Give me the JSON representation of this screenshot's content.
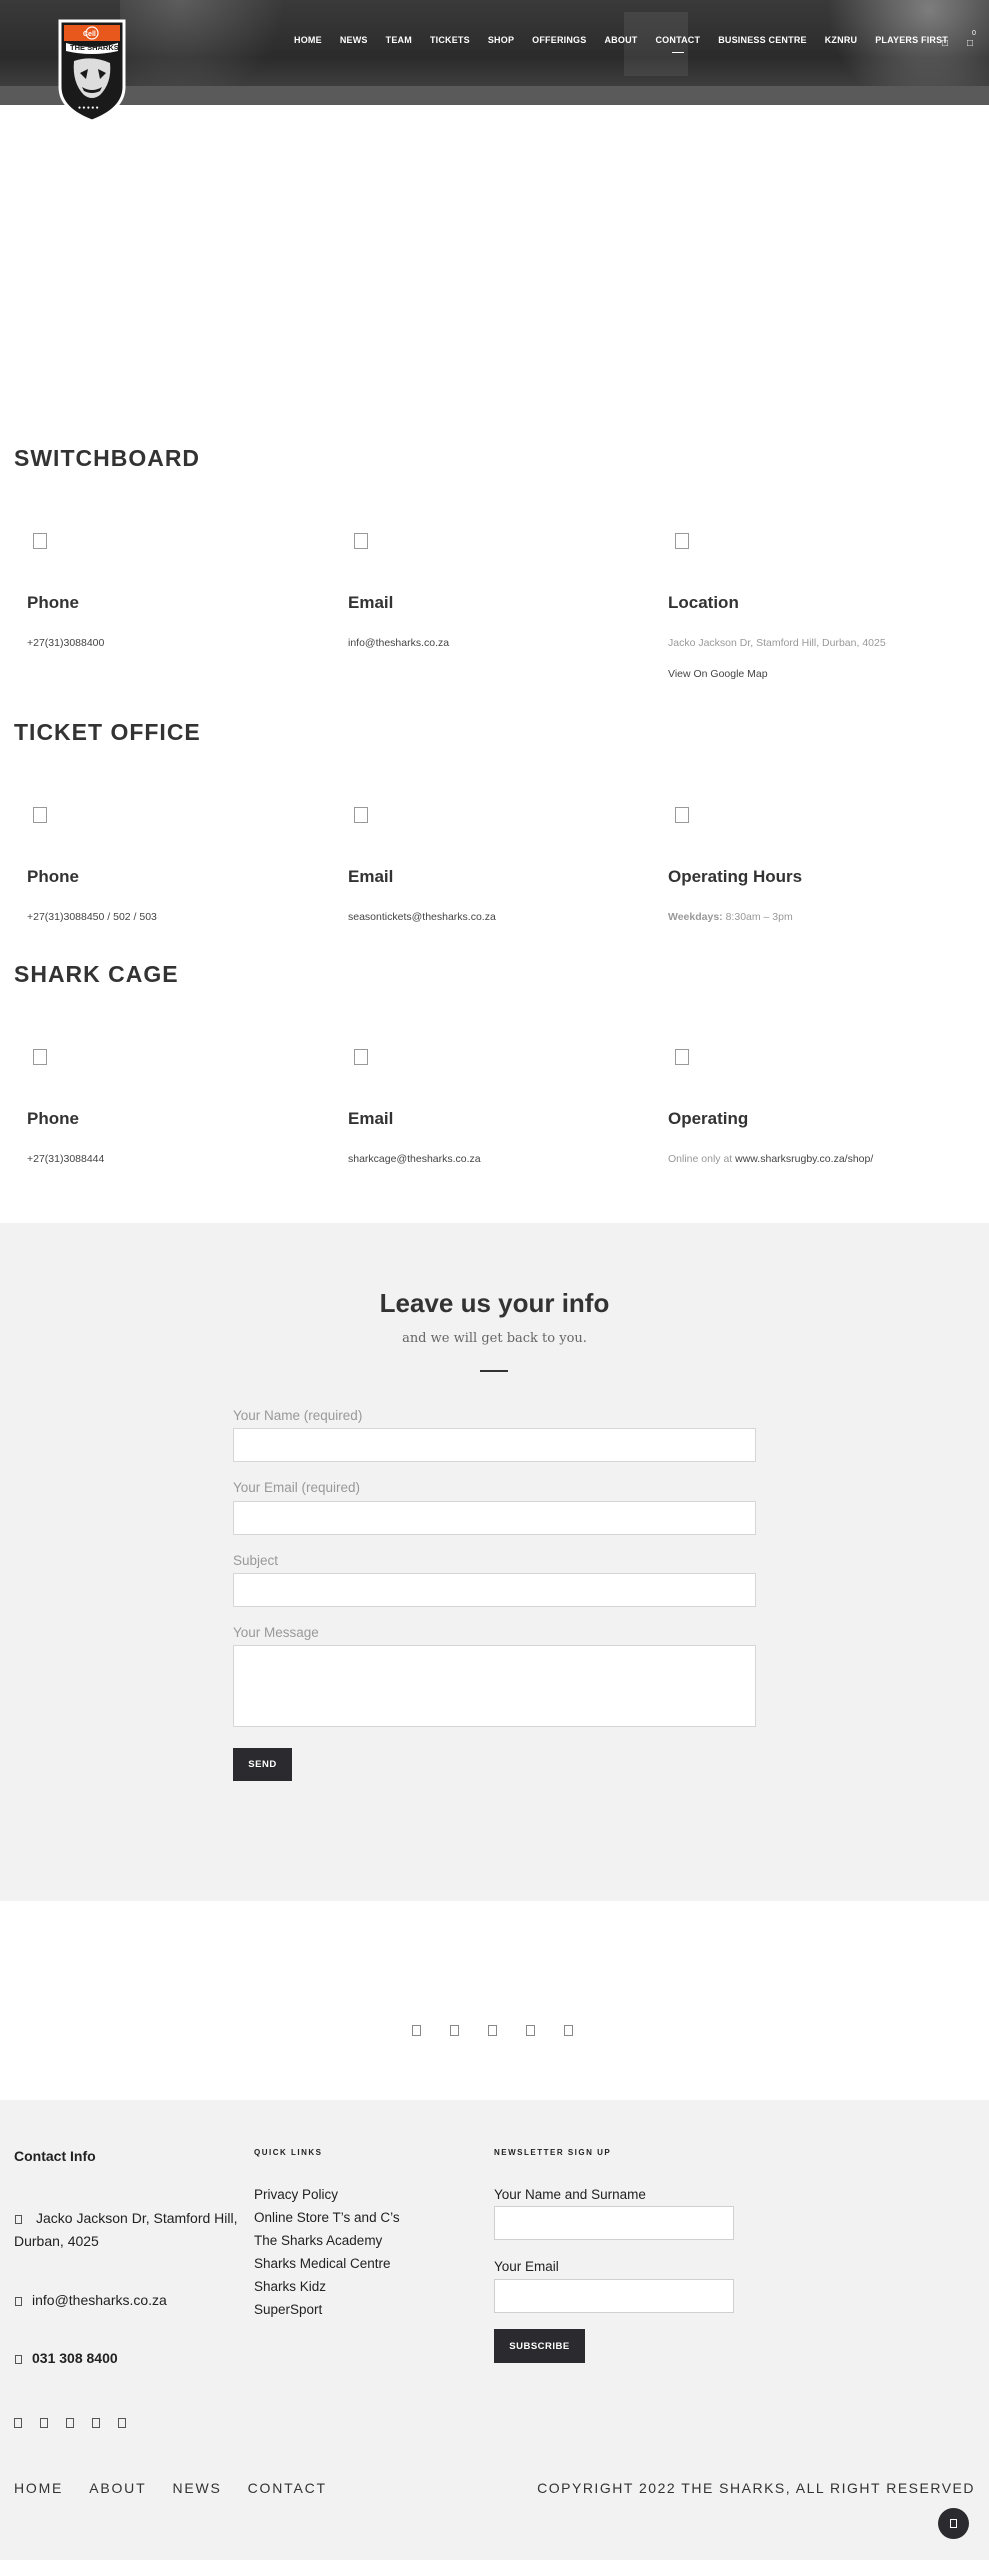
{
  "header": {
    "logo_text": "THE SHARKS",
    "logo_badge": "Cell C",
    "nav": [
      "HOME",
      "NEWS",
      "TEAM",
      "TICKETS",
      "SHOP",
      "OFFERINGS",
      "ABOUT",
      "CONTACT",
      "BUSINESS CENTRE",
      "KZNRU",
      "PLAYERS FIRST"
    ],
    "active_nav": "CONTACT",
    "cart_count": "0",
    "search_icon": "search-icon",
    "cart_icon": "cart-icon"
  },
  "sections": [
    {
      "title": "SWITCHBOARD",
      "cards": [
        {
          "title": "Phone",
          "icon": "phone-icon",
          "text": "+27(31)3088400"
        },
        {
          "title": "Email",
          "icon": "email-icon",
          "text": "info@thesharks.co.za"
        },
        {
          "title": "Location",
          "icon": "location-icon",
          "text": "Jacko Jackson Dr, Stamford Hill, Durban, 4025",
          "link": "View On Google Map"
        }
      ]
    },
    {
      "title": "TICKET OFFICE",
      "cards": [
        {
          "title": "Phone",
          "icon": "phone-icon",
          "text": "+27(31)3088450 / 502 / 503"
        },
        {
          "title": "Email",
          "icon": "email-icon",
          "text": "seasontickets@thesharks.co.za"
        },
        {
          "title": "Operating Hours",
          "icon": "clock-icon",
          "label": "Weekdays:",
          "text": "8:30am – 3pm"
        }
      ]
    },
    {
      "title": "SHARK CAGE",
      "cards": [
        {
          "title": "Phone",
          "icon": "phone-icon",
          "text": "+27(31)3088444"
        },
        {
          "title": "Email",
          "icon": "email-icon",
          "text": "sharkcage@thesharks.co.za"
        },
        {
          "title": "Operating",
          "icon": "clock-icon",
          "label": "Online only at",
          "text": "www.sharksrugby.co.za/shop/"
        }
      ]
    }
  ],
  "form": {
    "title": "Leave us your info",
    "subtitle": "and we will get back to you.",
    "name_label": "Your Name (required)",
    "email_label": "Your Email (required)",
    "subject_label": "Subject",
    "message_label": "Your Message",
    "send_label": "SEND"
  },
  "social_icons": [
    "facebook-icon",
    "twitter-icon",
    "instagram-icon",
    "youtube-icon",
    "linkedin-icon"
  ],
  "footer": {
    "contact_heading": "Contact Info",
    "address": "Jacko Jackson Dr, Stamford Hill, Durban, 4025",
    "email": "info@thesharks.co.za",
    "phone": "031 308 8400",
    "quick_links_heading": "QUICK LINKS",
    "quick_links": [
      "Privacy Policy",
      "Online Store T’s and C’s",
      "The Sharks Academy",
      "Sharks Medical Centre",
      "Sharks Kidz",
      "SuperSport"
    ],
    "newsletter_heading": "NEWSLETTER SIGN UP",
    "newsletter_name_label": "Your Name and Surname",
    "newsletter_email_label": "Your Email",
    "subscribe_label": "SUBSCRIBE",
    "bottom_nav": [
      "HOME",
      "ABOUT",
      "NEWS",
      "CONTACT"
    ],
    "copyright": "COPYRIGHT 2022 THE SHARKS, ALL RIGHT RESERVED"
  },
  "colors": {
    "header_dark": "#2b2b2b",
    "button_dark": "#2b2b2f",
    "logo_orange": "#e8581c",
    "panel_gray": "#f2f2f2"
  }
}
